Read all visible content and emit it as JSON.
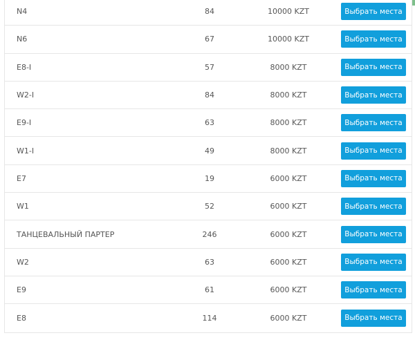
{
  "button_label": "Выбрать места",
  "rows": [
    {
      "sector": "N4",
      "seats": "84",
      "price": "10000 KZT"
    },
    {
      "sector": "N6",
      "seats": "67",
      "price": "10000 KZT"
    },
    {
      "sector": "E8-I",
      "seats": "57",
      "price": "8000 KZT"
    },
    {
      "sector": "W2-I",
      "seats": "84",
      "price": "8000 KZT"
    },
    {
      "sector": "E9-I",
      "seats": "63",
      "price": "8000 KZT"
    },
    {
      "sector": "W1-I",
      "seats": "49",
      "price": "8000 KZT"
    },
    {
      "sector": "E7",
      "seats": "19",
      "price": "6000 KZT"
    },
    {
      "sector": "W1",
      "seats": "52",
      "price": "6000 KZT"
    },
    {
      "sector": "ТАНЦЕВАЛЬНЫЙ ПАРТЕР",
      "seats": "246",
      "price": "6000 KZT"
    },
    {
      "sector": "W2",
      "seats": "63",
      "price": "6000 KZT"
    },
    {
      "sector": "E9",
      "seats": "61",
      "price": "6000 KZT"
    },
    {
      "sector": "E8",
      "seats": "114",
      "price": "6000 KZT"
    }
  ],
  "colors": {
    "button": "#119fdc",
    "text": "#555555",
    "border": "#e6e6e6"
  }
}
